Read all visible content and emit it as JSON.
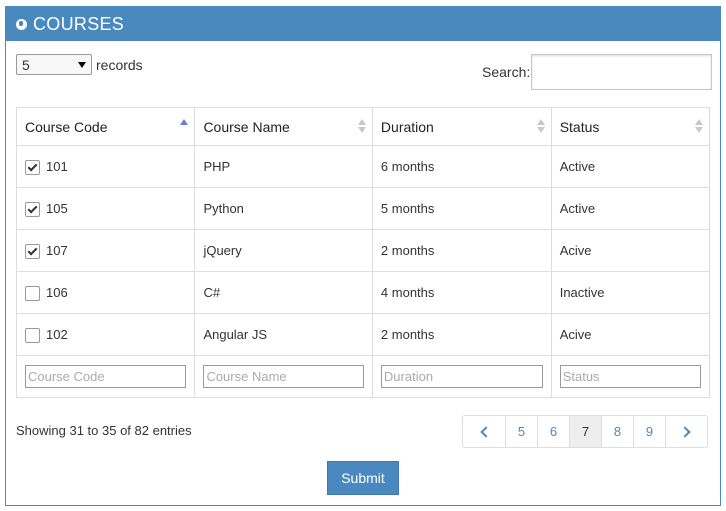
{
  "panel": {
    "title": "COURSES"
  },
  "length": {
    "selected": "5",
    "label": "records"
  },
  "search": {
    "label": "Search:",
    "value": ""
  },
  "table": {
    "columns": [
      "Course Code",
      "Course Name",
      "Duration",
      "Status"
    ],
    "rows": [
      {
        "checked": true,
        "code": "101",
        "name": "PHP",
        "duration": "6 months",
        "status": "Active"
      },
      {
        "checked": true,
        "code": "105",
        "name": "Python",
        "duration": "5 months",
        "status": "Active"
      },
      {
        "checked": true,
        "code": "107",
        "name": "jQuery",
        "duration": "2 months",
        "status": "Acive"
      },
      {
        "checked": false,
        "code": "106",
        "name": "C#",
        "duration": "4 months",
        "status": "Inactive"
      },
      {
        "checked": false,
        "code": "102",
        "name": "Angular JS",
        "duration": "2 months",
        "status": "Acive"
      }
    ],
    "filters": [
      "Course Code",
      "Course Name",
      "Duration",
      "Status"
    ]
  },
  "info": "Showing 31 to 35 of 82 entries",
  "pagination": {
    "pages": [
      "5",
      "6",
      "7",
      "8",
      "9"
    ],
    "current": "7"
  },
  "submit_label": "Submit",
  "colors": {
    "accent": "#4a89c0",
    "sort_active": "#6d7fcc"
  }
}
